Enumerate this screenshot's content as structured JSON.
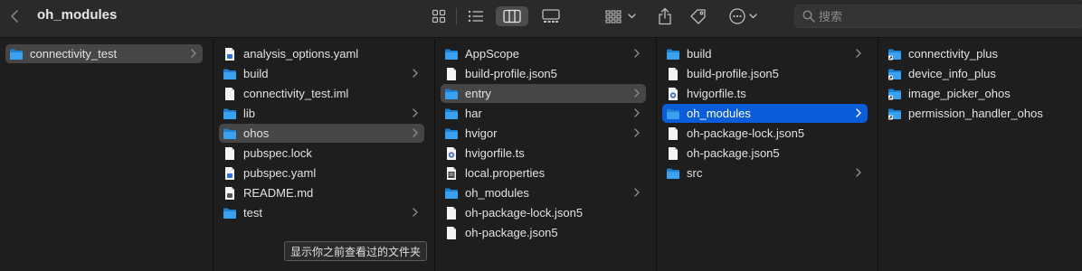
{
  "window": {
    "title": "oh_modules"
  },
  "toolbar": {
    "search_placeholder": "搜索"
  },
  "tooltip": "显示你之前查看过的文件夹",
  "colors": {
    "selection_blue": "#0b5cd8",
    "folder_blue": "#3aa0f0",
    "selection_dim": "#464646"
  },
  "columns": [
    {
      "items": [
        {
          "label": "connectivity_test",
          "type": "folder",
          "chevron": true
        }
      ]
    },
    {
      "items": [
        {
          "label": "analysis_options.yaml",
          "type": "file-yaml",
          "chevron": false
        },
        {
          "label": "build",
          "type": "folder",
          "chevron": true
        },
        {
          "label": "connectivity_test.iml",
          "type": "file",
          "chevron": false
        },
        {
          "label": "lib",
          "type": "folder",
          "chevron": true
        },
        {
          "label": "ohos",
          "type": "folder",
          "chevron": true
        },
        {
          "label": "pubspec.lock",
          "type": "file",
          "chevron": false
        },
        {
          "label": "pubspec.yaml",
          "type": "file-yaml",
          "chevron": false
        },
        {
          "label": "README.md",
          "type": "file-md",
          "chevron": false
        },
        {
          "label": "test",
          "type": "folder",
          "chevron": true
        }
      ]
    },
    {
      "items": [
        {
          "label": "AppScope",
          "type": "folder",
          "chevron": true
        },
        {
          "label": "build-profile.json5",
          "type": "file",
          "chevron": false
        },
        {
          "label": "entry",
          "type": "folder",
          "chevron": true
        },
        {
          "label": "har",
          "type": "folder",
          "chevron": true
        },
        {
          "label": "hvigor",
          "type": "folder",
          "chevron": true
        },
        {
          "label": "hvigorfile.ts",
          "type": "file-ts",
          "chevron": false
        },
        {
          "label": "local.properties",
          "type": "file-props",
          "chevron": false
        },
        {
          "label": "oh_modules",
          "type": "folder",
          "chevron": true
        },
        {
          "label": "oh-package-lock.json5",
          "type": "file",
          "chevron": false
        },
        {
          "label": "oh-package.json5",
          "type": "file",
          "chevron": false
        }
      ]
    },
    {
      "items": [
        {
          "label": "build",
          "type": "folder",
          "chevron": true
        },
        {
          "label": "build-profile.json5",
          "type": "file",
          "chevron": false
        },
        {
          "label": "hvigorfile.ts",
          "type": "file-ts",
          "chevron": false
        },
        {
          "label": "oh_modules",
          "type": "folder",
          "chevron": true
        },
        {
          "label": "oh-package-lock.json5",
          "type": "file",
          "chevron": false
        },
        {
          "label": "oh-package.json5",
          "type": "file",
          "chevron": false
        },
        {
          "label": "src",
          "type": "folder",
          "chevron": true
        }
      ]
    },
    {
      "items": [
        {
          "label": "connectivity_plus",
          "type": "folder-alias",
          "chevron": false
        },
        {
          "label": "device_info_plus",
          "type": "folder-alias",
          "chevron": false
        },
        {
          "label": "image_picker_ohos",
          "type": "folder-alias",
          "chevron": false
        },
        {
          "label": "permission_handler_ohos",
          "type": "folder-alias",
          "chevron": false
        }
      ]
    }
  ]
}
